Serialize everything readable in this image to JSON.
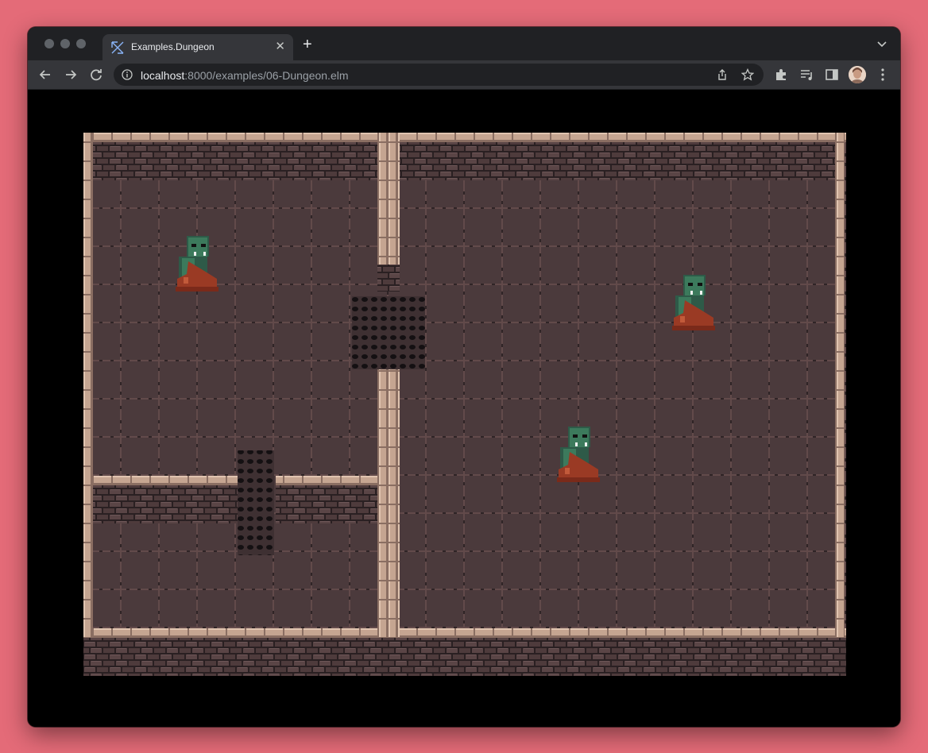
{
  "browser": {
    "tab_title": "Examples.Dungeon",
    "url_host": "localhost",
    "url_rest": ":8000/examples/06-Dungeon.elm",
    "icons": {
      "tab": "elm-tangram-icon",
      "close": "close-icon",
      "new_tab": "plus-icon",
      "tab_menu": "chevron-down-icon",
      "back": "arrow-left-icon",
      "forward": "arrow-right-icon",
      "reload": "reload-icon",
      "site_info": "info-icon",
      "share": "share-icon",
      "bookmark": "star-icon",
      "extensions": "puzzle-icon",
      "media": "playlist-icon",
      "side_panel": "side-panel-icon",
      "profile": "avatar",
      "menu": "kebab-menu-icon"
    }
  },
  "game": {
    "colors": {
      "floor": "#4b3a3c",
      "floor_line": "#624a4a",
      "brick": "#5a4546",
      "mortar": "#2a2022",
      "wall_trim": "#c5a591",
      "wall_trim_dark": "#8a6e62",
      "orc_skin": "#3c7a5c",
      "orc_cloak": "#9a3a24",
      "orc_hood": "#2e5a48"
    },
    "enemies": [
      {
        "name": "orc"
      },
      {
        "name": "orc"
      },
      {
        "name": "orc"
      }
    ]
  }
}
